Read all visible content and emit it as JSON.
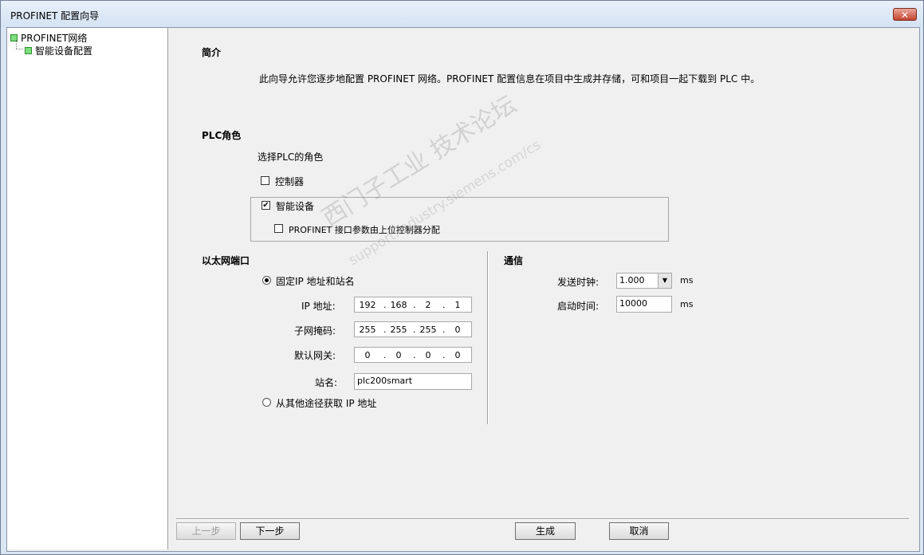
{
  "window": {
    "title": "PROFINET 配置向导",
    "close_label": "✕"
  },
  "tree": {
    "root": "PROFINET网络",
    "child": "智能设备配置"
  },
  "intro": {
    "heading": "简介",
    "text": "此向导允许您逐步地配置 PROFINET 网络。PROFINET 配置信息在项目中生成并存储，可和项目一起下载到 PLC 中。"
  },
  "plc_role": {
    "heading": "PLC角色",
    "prompt": "选择PLC的角色",
    "controller": {
      "label": "控制器",
      "checked": false
    },
    "smart_device": {
      "label": "智能设备",
      "checked": true
    },
    "upper_assign": {
      "label": "PROFINET 接口参数由上位控制器分配",
      "checked": false
    }
  },
  "ethernet": {
    "heading": "以太网端口",
    "fixed_ip": {
      "label": "固定IP 地址和站名",
      "selected": true
    },
    "ip_label": "IP 地址:",
    "ip": [
      "192",
      "168",
      "2",
      "1"
    ],
    "mask_label": "子网掩码:",
    "mask": [
      "255",
      "255",
      "255",
      "0"
    ],
    "gateway_label": "默认网关:",
    "gateway": [
      "0",
      "0",
      "0",
      "0"
    ],
    "station_label": "站名:",
    "station": "plc200smart",
    "other": {
      "label": "从其他途径获取 IP 地址",
      "selected": false
    }
  },
  "comm": {
    "heading": "通信",
    "send_clock_label": "发送时钟:",
    "send_clock": "1.000",
    "startup_label": "启动时间:",
    "startup": "10000",
    "unit": "ms"
  },
  "buttons": {
    "prev": "上一步",
    "next": "下一步",
    "generate": "生成",
    "cancel": "取消"
  },
  "watermark": {
    "line1": "西门子工业  技术论坛",
    "line2": "support.industry.siemens.com/cs"
  },
  "colors": {
    "tree_node": "#7be07b",
    "close_button": "#c5442f",
    "panel": "#f0f0f0"
  }
}
